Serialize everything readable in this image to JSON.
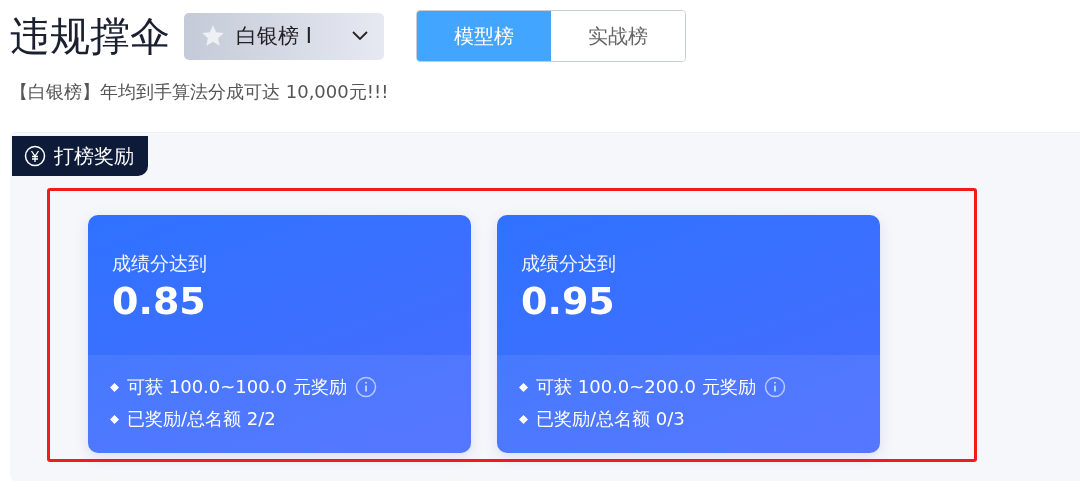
{
  "title": "违规撑伞",
  "tier_select": {
    "value": "白银榜 I"
  },
  "tabs": [
    {
      "label": "模型榜",
      "selected": true
    },
    {
      "label": "实战榜",
      "selected": false
    }
  ],
  "subtitle": "【白银榜】年均到手算法分成可达 10,000元!!!",
  "rewards": {
    "tag": "打榜奖励",
    "cards": [
      {
        "label": "成绩分达到",
        "score": "0.85",
        "reward": "可获 100.0~100.0 元奖励",
        "quota": "已奖励/总名额 2/2"
      },
      {
        "label": "成绩分达到",
        "score": "0.95",
        "reward": "可获 100.0~200.0 元奖励",
        "quota": "已奖励/总名额 0/3"
      }
    ]
  }
}
